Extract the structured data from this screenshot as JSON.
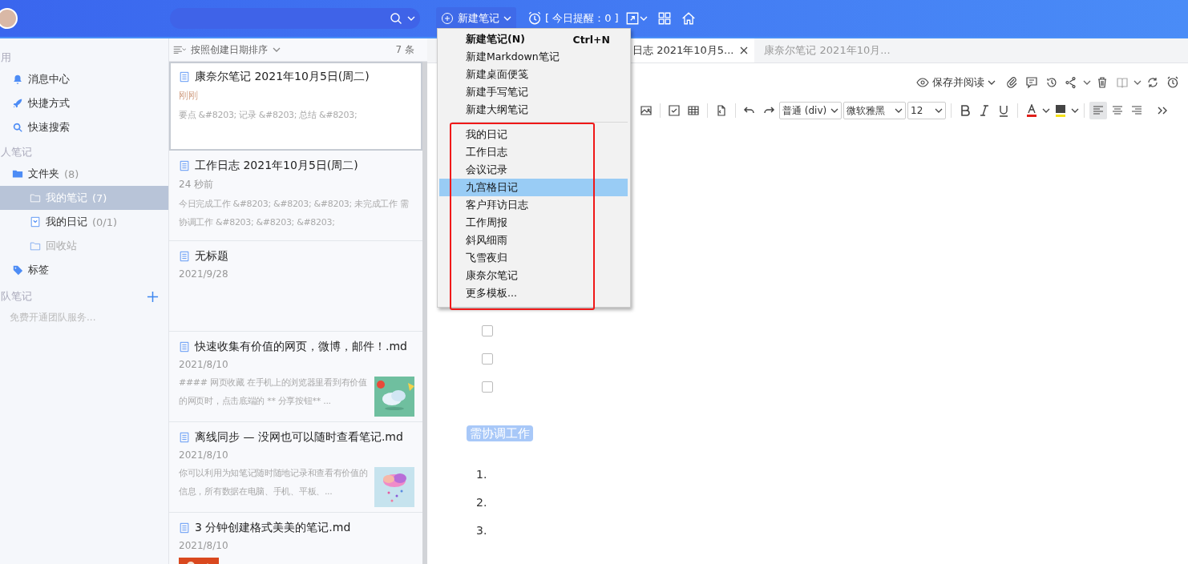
{
  "top_bar": {
    "new_note_button": {
      "label": "新建笔记"
    },
    "reminder": "[ 今日提醒：0 ]"
  },
  "sidebar": {
    "sections": [
      {
        "title": "用",
        "items": [
          {
            "label": "消息中心",
            "selected": false
          },
          {
            "label": "快捷方式",
            "selected": false
          },
          {
            "label": "快速搜索",
            "selected": false
          }
        ]
      },
      {
        "title": "人笔记",
        "items": [
          {
            "label": "文件夹",
            "count": "(8)",
            "selected": false,
            "children": [
              {
                "label": "我的笔记",
                "count": "(7)",
                "selected": true
              },
              {
                "label": "我的日记",
                "count": "(0/1)",
                "selected": false
              },
              {
                "label": "回收站",
                "selected": false
              }
            ]
          },
          {
            "label": "标签",
            "selected": false
          }
        ]
      }
    ],
    "team": {
      "title": "队笔记",
      "hint": "免费开通团队服务..."
    }
  },
  "note_list": {
    "sort_label": "按照创建日期排序",
    "count": "7 条",
    "notes": [
      {
        "title": "康奈尔笔记 2021年10月5日(周二)",
        "time": "刚刚",
        "recent": true,
        "snippet": "要点 &#8203; 记录 &#8203; 总结 &#8203;",
        "selected": true
      },
      {
        "title": "工作日志 2021年10月5日(周二)",
        "time": "24 秒前",
        "recent": false,
        "snippet": "今日完成工作 &#8203; &#8203; &#8203; 未完成工作 需协调工作 &#8203; &#8203; &#8203;",
        "selected": false
      },
      {
        "title": "无标题",
        "time": "2021/9/28",
        "recent": false,
        "selected": false
      },
      {
        "title": "快速收集有价值的网页，微博，邮件！.md",
        "time": "2021/8/10",
        "recent": false,
        "snippet": " #### 网页收藏 在手机上的浏览器里看到有价值的网页时，点击底端的 ** 分享按钮** ...",
        "picture": true,
        "selected": false
      },
      {
        "title": "离线同步 — 没网也可以随时查看笔记.md",
        "time": "2021/8/10",
        "recent": false,
        "snippet": "你可以利用为知笔记随时随地记录和查看有价值的信息，所有数据在电脑、手机、平板、...",
        "picture": true,
        "selected": false
      },
      {
        "title": "3 分钟创建格式美美的笔记.md",
        "time": "2021/8/10",
        "recent": false,
        "picture": true,
        "selected": false
      }
    ]
  },
  "tabs": [
    {
      "label": "日志 2021年10月5...",
      "selected": true,
      "closable": true
    },
    {
      "label": "康奈尔笔记 2021年10月...",
      "selected": false,
      "closable": false
    }
  ],
  "toolbar": {
    "save_read": "保存并阅读",
    "paragraph": "普通 (div)",
    "font": "微软雅黑",
    "size": "12"
  },
  "editor": {
    "blocks": [
      {
        "kind": "checkbox",
        "checked": false
      },
      {
        "kind": "checkbox",
        "checked": false
      },
      {
        "kind": "checkbox",
        "checked": false
      },
      {
        "kind": "heading",
        "text": "需协调工作"
      },
      {
        "kind": "numbered",
        "number": "1."
      },
      {
        "kind": "numbered",
        "number": "2."
      },
      {
        "kind": "numbered",
        "number": "3."
      }
    ]
  },
  "new_menu": {
    "items": [
      {
        "kind": "item",
        "label": "新建笔记(N)",
        "shortcut": "Ctrl+N",
        "default": true,
        "selected": false
      },
      {
        "kind": "item",
        "label": "新建Markdown笔记",
        "default": false,
        "selected": false
      },
      {
        "kind": "item",
        "label": "新建桌面便笺",
        "default": false,
        "selected": false
      },
      {
        "kind": "item",
        "label": "新建手写笔记",
        "default": false,
        "selected": false
      },
      {
        "kind": "item",
        "label": "新建大纲笔记",
        "default": false,
        "selected": false
      },
      {
        "kind": "separator"
      },
      {
        "kind": "item",
        "label": "我的日记",
        "default": false,
        "selected": false
      },
      {
        "kind": "item",
        "label": "工作日志",
        "default": false,
        "selected": false
      },
      {
        "kind": "item",
        "label": "会议记录",
        "default": false,
        "selected": false
      },
      {
        "kind": "item",
        "label": "九宫格日记",
        "default": false,
        "selected": true
      },
      {
        "kind": "item",
        "label": "客户拜访日志",
        "default": false,
        "selected": false
      },
      {
        "kind": "item",
        "label": "工作周报",
        "default": false,
        "selected": false
      },
      {
        "kind": "item",
        "label": "斜风细雨",
        "default": false,
        "selected": false
      },
      {
        "kind": "item",
        "label": "飞雪夜归",
        "default": false,
        "selected": false
      },
      {
        "kind": "item",
        "label": "康奈尔笔记",
        "default": false,
        "selected": false
      },
      {
        "kind": "item",
        "label": "更多模板...",
        "default": false,
        "selected": false
      }
    ]
  }
}
